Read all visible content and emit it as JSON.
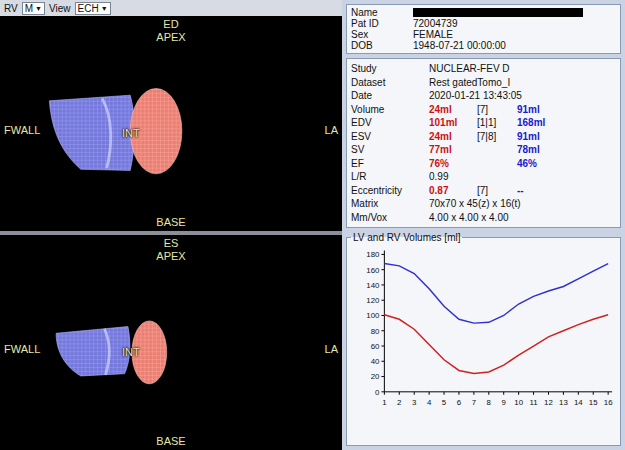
{
  "toolbar": [
    {
      "kind": "label",
      "text": "RV"
    },
    {
      "kind": "dropdown",
      "text": "M",
      "arrow": "▼"
    },
    {
      "kind": "label",
      "text": "View"
    },
    {
      "kind": "dropdown",
      "text": "ECH",
      "arrow": "▼"
    }
  ],
  "views": [
    {
      "phase": "ED",
      "labels": {
        "top": "APEX",
        "left": "FWALL",
        "center": "INT",
        "right": "LA",
        "bottom": "BASE"
      }
    },
    {
      "phase": "ES",
      "labels": {
        "top": "APEX",
        "left": "FWALL",
        "center": "INT",
        "right": "LA",
        "bottom": "BASE"
      }
    }
  ],
  "patient": [
    {
      "label": "Name",
      "value": "",
      "redacted": true
    },
    {
      "label": "Pat ID",
      "value": "72004739",
      "redacted": false
    },
    {
      "label": "Sex",
      "value": "FEMALE",
      "redacted": false
    },
    {
      "label": "DOB",
      "value": "1948-07-21 00:00:00",
      "redacted": false
    }
  ],
  "study": [
    {
      "kind": "text",
      "label": "Study",
      "value": "NUCLEAR-FEV D"
    },
    {
      "kind": "text",
      "label": "Dataset",
      "value": "Rest gatedTomo_I"
    },
    {
      "kind": "text",
      "label": "Date",
      "value": "2020-01-21 13:43:05"
    },
    {
      "kind": "measure",
      "label": "Volume",
      "lv": "24ml",
      "bracket": "[7]",
      "rv": "91ml"
    },
    {
      "kind": "measure",
      "label": "EDV",
      "lv": "101ml",
      "bracket": "[1|1]",
      "rv": "168ml"
    },
    {
      "kind": "measure",
      "label": "ESV",
      "lv": "24ml",
      "bracket": "[7|8]",
      "rv": "91ml"
    },
    {
      "kind": "measure",
      "label": "SV",
      "lv": "77ml",
      "bracket": "",
      "rv": "78ml"
    },
    {
      "kind": "measure",
      "label": "EF",
      "lv": "76%",
      "bracket": "",
      "rv": "46%"
    },
    {
      "kind": "text",
      "label": "L/R",
      "value": "0.99"
    },
    {
      "kind": "measure",
      "label": "Eccentricity",
      "lv": "0.87",
      "bracket": "[7]",
      "rv": "--"
    },
    {
      "kind": "text",
      "label": "Matrix",
      "value": "70x70 x 45(z) x 16(t)"
    },
    {
      "kind": "text",
      "label": "Mm/Vox",
      "value": "4.00 x 4.00 x 4.00"
    }
  ],
  "chart": {
    "title": "LV and RV Volumes [ml]",
    "y_ticks": [
      "0",
      "20",
      "40",
      "60",
      "80",
      "100",
      "120",
      "140",
      "160",
      "180"
    ],
    "x_ticks": [
      "1",
      "2",
      "3",
      "4",
      "5",
      "6",
      "7",
      "8",
      "9",
      "10",
      "11",
      "12",
      "13",
      "14",
      "15",
      "16"
    ],
    "series": [
      {
        "color": "#3030d0",
        "values": [
          168,
          165,
          155,
          135,
          112,
          95,
          90,
          91,
          100,
          115,
          125,
          132,
          138,
          148,
          158,
          168
        ]
      },
      {
        "color": "#d02020",
        "values": [
          101,
          95,
          82,
          62,
          42,
          28,
          24,
          26,
          35,
          48,
          60,
          72,
          80,
          88,
          95,
          101
        ]
      }
    ]
  }
}
